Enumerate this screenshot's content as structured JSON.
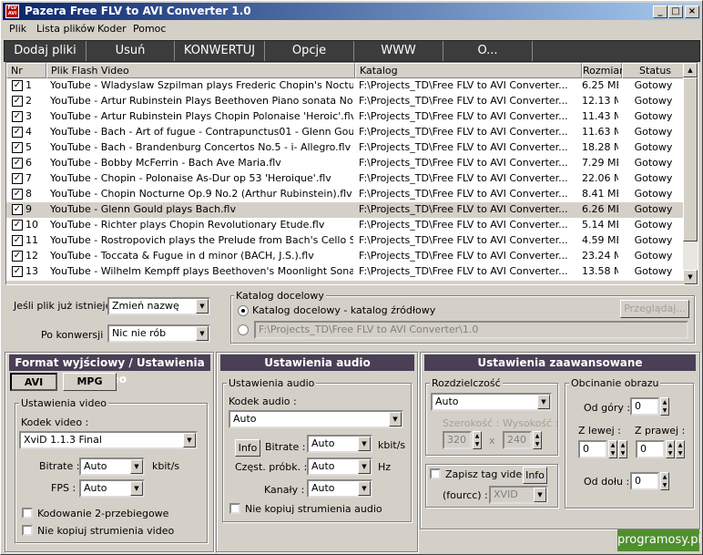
{
  "window": {
    "title": "Pazera Free FLV to AVI Converter 1.0",
    "min": "_",
    "max": "□",
    "close": "×"
  },
  "menu": [
    "Plik",
    "Lista plików",
    "Koder",
    "Pomoc"
  ],
  "toolbar": [
    "Dodaj pliki",
    "Usuń",
    "KONWERTUJ",
    "Opcje",
    "WWW",
    "O..."
  ],
  "list": {
    "headers": [
      "Nr",
      "Plik Flash Video",
      "Katalog",
      "Rozmiar",
      "Status"
    ],
    "rows": [
      [
        "1",
        "YouTube - Wladyslaw Szpilman plays Frederic Chopin's Nocturne i...",
        "F:\\Projects_TD\\Free FLV to AVI Converter...",
        "6.25 MB",
        "Gotowy"
      ],
      [
        "2",
        "YouTube - Artur Rubinstein Plays Beethoven Piano sonata No.23 ...",
        "F:\\Projects_TD\\Free FLV to AVI Converter...",
        "12.13 MB",
        "Gotowy"
      ],
      [
        "3",
        "YouTube - Artur Rubinstein Plays Chopin Polonaise 'Heroic'.flv",
        "F:\\Projects_TD\\Free FLV to AVI Converter...",
        "11.43 MB",
        "Gotowy"
      ],
      [
        "4",
        "YouTube - Bach - Art of fugue - Contrapunctus01 - Glenn Gould.flv",
        "F:\\Projects_TD\\Free FLV to AVI Converter...",
        "11.63 MB",
        "Gotowy"
      ],
      [
        "5",
        "YouTube - Bach - Brandenburg Concertos No.5 - i- Allegro.flv",
        "F:\\Projects_TD\\Free FLV to AVI Converter...",
        "18.28 MB",
        "Gotowy"
      ],
      [
        "6",
        "YouTube - Bobby McFerrin - Bach Ave Maria.flv",
        "F:\\Projects_TD\\Free FLV to AVI Converter...",
        "7.29 MB",
        "Gotowy"
      ],
      [
        "7",
        "YouTube - Chopin - Polonaise As-Dur op 53 'Heroique'.flv",
        "F:\\Projects_TD\\Free FLV to AVI Converter...",
        "22.06 MB",
        "Gotowy"
      ],
      [
        "8",
        "YouTube - Chopin Nocturne Op.9 No.2 (Arthur Rubinstein).flv",
        "F:\\Projects_TD\\Free FLV to AVI Converter...",
        "8.41 MB",
        "Gotowy"
      ],
      [
        "9",
        "YouTube - Glenn Gould plays Bach.flv",
        "F:\\Projects_TD\\Free FLV to AVI Converter...",
        "6.26 MB",
        "Gotowy"
      ],
      [
        "10",
        "YouTube - Richter plays Chopin Revolutionary Etude.flv",
        "F:\\Projects_TD\\Free FLV to AVI Converter...",
        "5.14 MB",
        "Gotowy"
      ],
      [
        "11",
        "YouTube - Rostropovich plays the Prelude from Bach's Cello Suite ...",
        "F:\\Projects_TD\\Free FLV to AVI Converter...",
        "4.59 MB",
        "Gotowy"
      ],
      [
        "12",
        "YouTube - Toccata & Fugue in d minor (BACH, J.S.).flv",
        "F:\\Projects_TD\\Free FLV to AVI Converter...",
        "23.24 MB",
        "Gotowy"
      ],
      [
        "13",
        "YouTube - Wilhelm Kempff plays Beethoven's Moonlight Sonata m...",
        "F:\\Projects_TD\\Free FLV to AVI Converter...",
        "13.58 MB",
        "Gotowy"
      ]
    ],
    "selected_row": 9
  },
  "opts": {
    "exists_label": "Jeśli plik już istnieje :",
    "exists_value": "Zmień nazwę",
    "after_label": "Po konwersji :",
    "after_value": "Nic nie rób",
    "dest_group": "Katalog docelowy",
    "dest_radio1": "Katalog docelowy - katalog źródłowy",
    "dest_browse": "Przeglądaj...",
    "dest_path": "F:\\Projects_TD\\Free FLV to AVI Converter\\1.0"
  },
  "video": {
    "head": "Format wyjściowy / Ustawienia video",
    "tab_avi": "AVI",
    "tab_mpg": "MPG",
    "group": "Ustawienia video",
    "codec_label": "Kodek video :",
    "codec": "XviD 1.1.3 Final",
    "bitrate_label": "Bitrate :",
    "bitrate": "Auto",
    "bitrate_unit": "kbit/s",
    "fps_label": "FPS :",
    "fps": "Auto",
    "twopass": "Kodowanie 2-przebiegowe",
    "nocopy": "Nie kopiuj strumienia video"
  },
  "audio": {
    "head": "Ustawienia audio",
    "group": "Ustawienia audio",
    "codec_label": "Kodek audio :",
    "codec": "Auto",
    "info": "Info",
    "bitrate_label": "Bitrate :",
    "bitrate": "Auto",
    "bitrate_unit": "kbit/s",
    "freq_label": "Częst. próbk. :",
    "freq": "Auto",
    "freq_unit": "Hz",
    "chan_label": "Kanały :",
    "chan": "Auto",
    "nocopy": "Nie kopiuj strumienia audio"
  },
  "adv": {
    "head": "Ustawienia zaawansowane",
    "res_group": "Rozdzielczość",
    "res": "Auto",
    "w_label": "Szerokość :",
    "h_label": "Wysokość :",
    "w": "320",
    "h": "240",
    "x": "x",
    "tag_check": "Zapisz tag video",
    "tag_info": "Info",
    "fourcc_label": "(fourcc) :",
    "fourcc": "XVID",
    "crop_group": "Obcinanie obrazu",
    "top_label": "Od góry :",
    "left_label": "Z lewej :",
    "right_label": "Z prawej :",
    "bottom_label": "Od dołu :",
    "top": "0",
    "left": "0",
    "right": "0",
    "bottom": "0"
  },
  "watermark": "programosy.pl"
}
